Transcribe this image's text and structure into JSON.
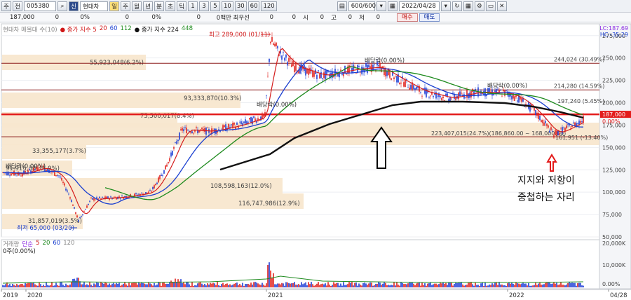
{
  "toolbar": {
    "type_label": "주",
    "prev_label": "전",
    "code": "005380",
    "market_badge": "신",
    "stock_name": "현대차",
    "periods": [
      "주",
      "월",
      "년",
      "분",
      "초",
      "틱"
    ],
    "intervals": [
      "1",
      "3",
      "5",
      "10",
      "30",
      "60",
      "120"
    ],
    "count": "600/600",
    "date": "2022/04/28"
  },
  "quote": {
    "price": "187,000",
    "change": "0",
    "change_pct": "0%",
    "volume": "0",
    "vol_pct": "0%",
    "special": "0",
    "special_label": "0백만 최우선",
    "best": "0",
    "zero2": "0",
    "open_label": "시",
    "open": "0",
    "high_label": "고",
    "high": "0",
    "low_label": "저",
    "low": "0",
    "buy_label": "매수",
    "sell_label": "매도"
  },
  "legend": {
    "title": "현대차 매물대 수(10)",
    "ma_label": "종가 지수",
    "ma_values": [
      "5",
      "20",
      "60",
      "112"
    ],
    "ma2_label": "종가 지수 224",
    "ma2_value": "448"
  },
  "lc_hc": {
    "lc": "LC:187.69",
    "hc": "HC:-35.29"
  },
  "volume_legend": {
    "title": "거래량",
    "ma_label": "단순",
    "values": [
      "5",
      "20",
      "60",
      "120"
    ],
    "zero_label": "0주(0.00%)"
  },
  "chart_data": {
    "type": "line",
    "ylim": [
      50000,
      285000
    ],
    "y_ticks": [
      "275,000",
      "250,000",
      "225,000",
      "200,000",
      "175,000",
      "150,000",
      "125,000",
      "100,000",
      "75,000",
      "50,000"
    ],
    "x_ticks": [
      "2019",
      "2020",
      "2021",
      "2022",
      "04/28"
    ],
    "current_price_tag": "187,000",
    "current_pct_tag": "0.00%",
    "volume_ticks": [
      "20,000K",
      "10,000K",
      "0.00%"
    ],
    "volume_profile": [
      {
        "label": "55,923,048(6.2%)",
        "price": 244024
      },
      {
        "label": "93,333,870(10.3%)",
        "price": 214280
      },
      {
        "label": "75,500,017(8.4%)",
        "price": 187000
      },
      {
        "label": "33,355,177(3.7%)",
        "price": 160000
      },
      {
        "label": "91,915,381(3.9%)",
        "price": 135000
      },
      {
        "label": "108,598,163(12.0%)",
        "price": 110000
      },
      {
        "label": "116,747,986(12.9%)",
        "price": 100000
      },
      {
        "label": "31,857,019(3.5%)",
        "price": 74000
      }
    ],
    "level_labels": [
      {
        "label": "244,024 (30.49%)",
        "price": 244024
      },
      {
        "label": "214,280 (14.59%)",
        "price": 214280
      },
      {
        "label": "197,240 (5.45%)",
        "price": 197240
      },
      {
        "label": "223,407,015(24.7%)(186,860.00 ~ 168,000.00)",
        "price": 180000
      },
      {
        "label": "161,951 (-13.40%)",
        "price": 161951
      }
    ],
    "annotations": [
      {
        "label": "최고 289,000 (01/11)"
      },
      {
        "label": "최저 65,000 (03/20)"
      },
      {
        "label": "배당락(0.00%)"
      }
    ],
    "overlay_text": [
      "지지와 저항이",
      "중첩하는 자리"
    ]
  }
}
